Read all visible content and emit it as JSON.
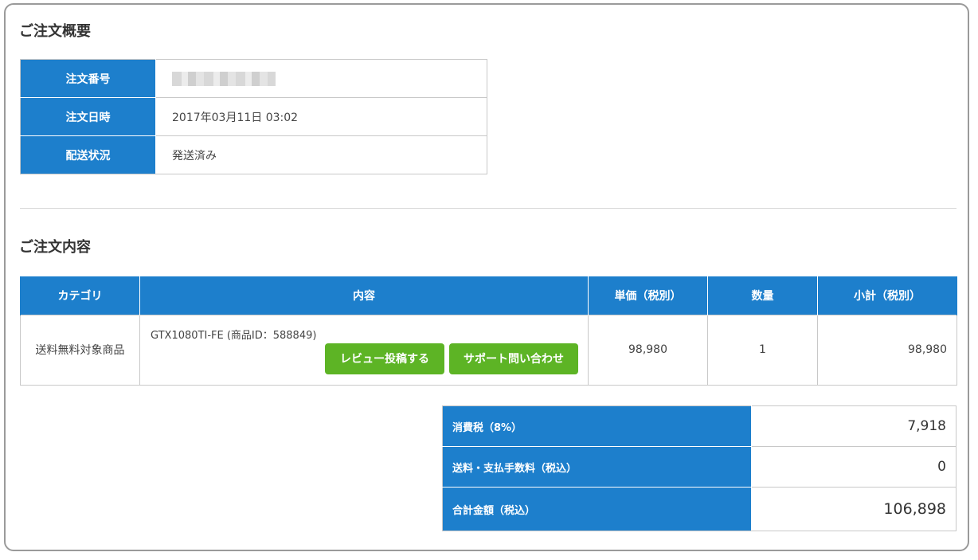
{
  "summary": {
    "title": "ご注文概要",
    "rows": [
      {
        "label": "注文番号",
        "value": ""
      },
      {
        "label": "注文日時",
        "value": "2017年03月11日 03:02"
      },
      {
        "label": "配送状況",
        "value": "発送済み"
      }
    ]
  },
  "details": {
    "title": "ご注文内容",
    "headers": [
      "カテゴリ",
      "内容",
      "単価（税別）",
      "数量",
      "小計（税別）"
    ],
    "item": {
      "category": "送料無料対象商品",
      "product": "GTX1080TI-FE (商品ID：588849)",
      "review_button": "レビュー投稿する",
      "support_button": "サポート問い合わせ",
      "unit_price": "98,980",
      "quantity": "1",
      "subtotal": "98,980"
    }
  },
  "totals": [
    {
      "label": "消費税（8%）",
      "value": "7,918"
    },
    {
      "label": "送料・支払手数料（税込）",
      "value": "0"
    },
    {
      "label": "合計金額（税込）",
      "value": "106,898"
    }
  ],
  "colors": {
    "header_blue": "#1d7fcc",
    "button_green": "#5db425"
  }
}
